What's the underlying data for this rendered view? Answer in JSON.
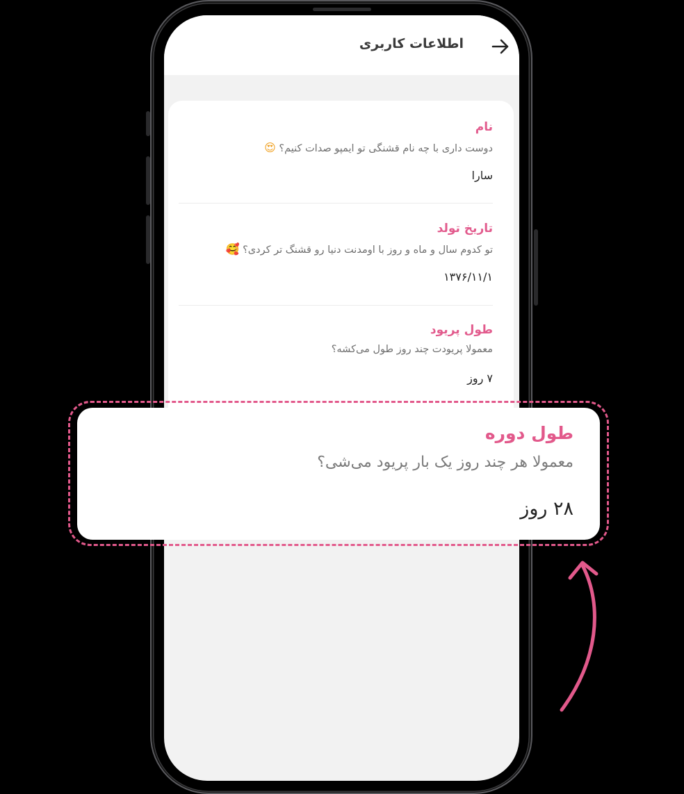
{
  "header": {
    "title": "اطلاعات کاربری",
    "back_icon": "arrow-right-icon"
  },
  "fields": [
    {
      "label": "نام",
      "question": "دوست داری با چه نام قشنگی تو ایمپو صدات کنیم؟",
      "emoji": "😍",
      "value": "سارا"
    },
    {
      "label": "تاریخ تولد",
      "question": "تو کدوم سال و ماه و روز با اومدنت دنیا رو قشنگ تر کردی؟",
      "emoji": "🥰",
      "value": "۱۳۷۶/۱۱/۱"
    },
    {
      "label": "طول پریود",
      "question": "معمولا پریودت چند روز طول می‌کشه؟",
      "value": "۷ روز"
    }
  ],
  "highlight": {
    "label": "طول دوره",
    "question": "معمولا هر چند روز یک بار پریود می‌شی؟",
    "value": "۲۸ روز"
  },
  "colors": {
    "accent": "#e2598b",
    "screen_bg": "#f2f2f2",
    "frame": "#1b1b1d"
  }
}
